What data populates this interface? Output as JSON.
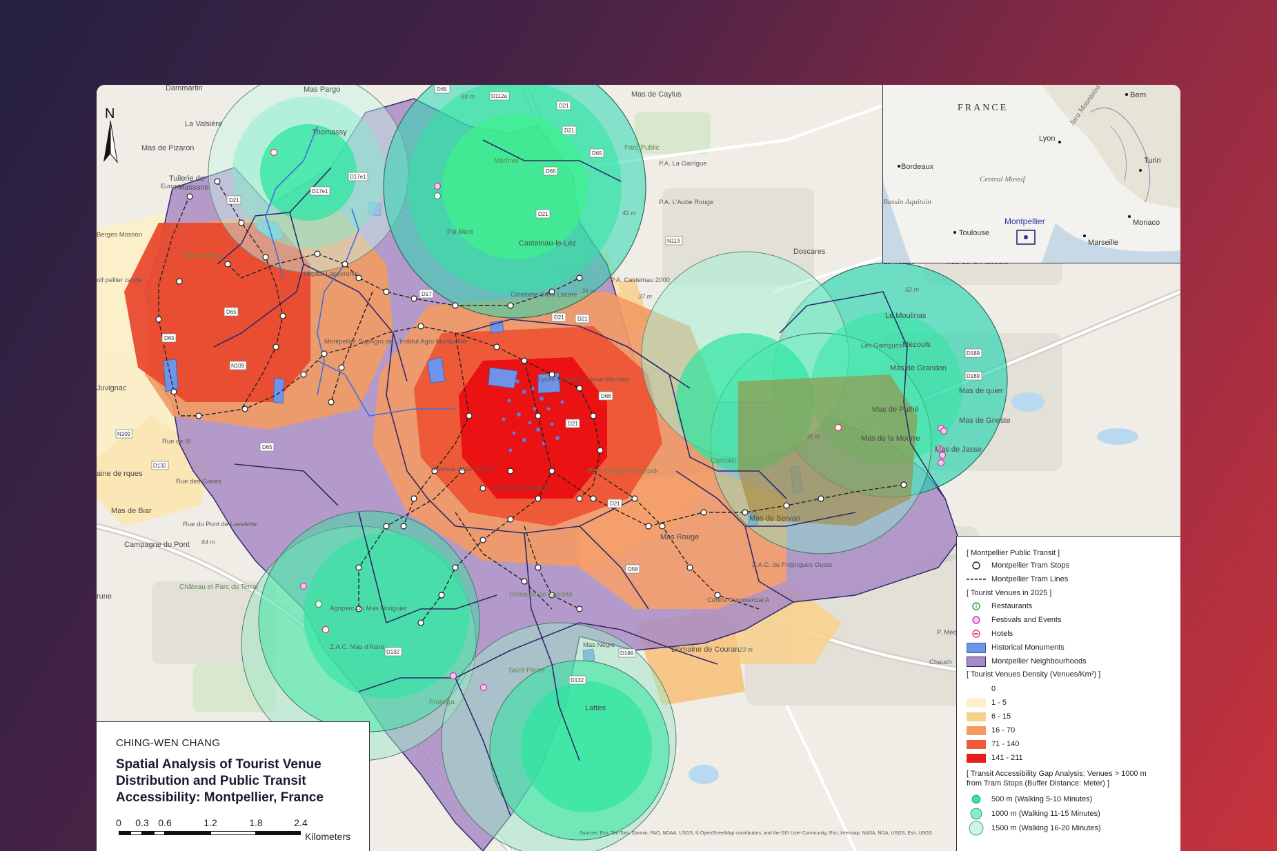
{
  "map": {
    "north_arrow": "N",
    "places": [
      {
        "id": "dammartin",
        "name": "Dammartin"
      },
      {
        "id": "mas-pargo",
        "name": "Mas Pargo"
      },
      {
        "id": "mas-de-caylus",
        "name": "Mas de Caylus"
      },
      {
        "id": "la-valsiere",
        "name": "La Valsière"
      },
      {
        "id": "thomassy",
        "name": "Thomassy"
      },
      {
        "id": "mas-de-pizaron",
        "name": "Mas de Pizaron"
      },
      {
        "id": "parc-public",
        "name": "Parc Public"
      },
      {
        "id": "pa-la-garrigue",
        "name": "P.A. La Garrigue"
      },
      {
        "id": "pa-laube-rouge",
        "name": "P.A. L'Aube Rouge"
      },
      {
        "id": "castelnau",
        "name": "Castelnau-le-Lez"
      },
      {
        "id": "doscares",
        "name": "Doscares"
      },
      {
        "id": "le-verteil",
        "name": "Le Verteil"
      },
      {
        "id": "mas-de-la-faissole",
        "name": "Mas de la Faissole"
      },
      {
        "id": "pa-castelnau-2000",
        "name": "P.A. Castelnau 2000"
      },
      {
        "id": "cimetiere",
        "name": "Cimetière Saint Lazare"
      },
      {
        "id": "hopital",
        "name": "Hôpital Lapeyronie"
      },
      {
        "id": "supagro",
        "name": "Montpellier SupAgro de L'Institut Agro Montpellier"
      },
      {
        "id": "juvignac",
        "name": "Juvignac"
      },
      {
        "id": "le-moulinas",
        "name": "Le Moulinas"
      },
      {
        "id": "mezouls",
        "name": "Mézouls"
      },
      {
        "id": "mas-de-grandon",
        "name": "Mas de Grandon"
      },
      {
        "id": "mas-de-pathe",
        "name": "Mas de Pathé"
      },
      {
        "id": "mas-de-la-mourre",
        "name": "Mas de la Mourre"
      },
      {
        "id": "mas-de-jasse",
        "name": "Mas de Jasse"
      },
      {
        "id": "mas-de-biar",
        "name": "Mas de Biar"
      },
      {
        "id": "campagne-du-pont",
        "name": "Campagne du Pont"
      },
      {
        "id": "chateau-terral",
        "name": "Château et Parc du Terral"
      },
      {
        "id": "mas-de-servan",
        "name": "Mas de Servan"
      },
      {
        "id": "mas-rouge",
        "name": "Mas Rouge"
      },
      {
        "id": "zac-frejorgues",
        "name": "Z.A.C. de Fréjorgues Ouest"
      },
      {
        "id": "centre-commercial",
        "name": "Centre Commercial A"
      },
      {
        "id": "domaine-couran",
        "name": "Domaine de Couran"
      },
      {
        "id": "lattes",
        "name": "Lattes"
      },
      {
        "id": "saint-pierre",
        "name": "Saint-Pierre"
      },
      {
        "id": "fromiga",
        "name": "Fromiga"
      },
      {
        "id": "saporta",
        "name": "Domaine de Saporta"
      },
      {
        "id": "parc-charpak",
        "name": "Parc Georges Charpak"
      },
      {
        "id": "comolet",
        "name": "Comolet"
      },
      {
        "id": "parc-malbosc",
        "name": "Parc Malbosc"
      },
      {
        "id": "martinet",
        "name": "Martinet"
      },
      {
        "id": "mas-negre",
        "name": "Mas Nègre"
      },
      {
        "id": "les-garrigues",
        "name": "Les Garrigues"
      },
      {
        "id": "rue-gieres",
        "name": "Rue des Gières"
      },
      {
        "id": "rue-lavalette",
        "name": "Rue du Pont de Lavalette"
      },
      {
        "id": "avenue-liberte",
        "name": "Avenue de la Liberté"
      },
      {
        "id": "avenue-palavas",
        "name": "Avenue de Palavas"
      },
      {
        "id": "europe",
        "name": "Europe"
      },
      {
        "id": "massane",
        "name": "Massane"
      },
      {
        "id": "tuilerie",
        "name": "Tuilerie de"
      },
      {
        "id": "berges-mosson",
        "name": "Berges Mosson"
      },
      {
        "id": "rue-bl",
        "name": "Rue de Bl"
      },
      {
        "id": "lycee",
        "name": "Lycée Polyvalent Jean Mermoz"
      },
      {
        "id": "agriparc",
        "name": "Agriparc Du Mas Nouguier"
      },
      {
        "id": "zac-mas-astre",
        "name": "Z.A.C. Mas d'Astre"
      },
      {
        "id": "chauch",
        "name": "Chauch"
      },
      {
        "id": "aine-de-rques",
        "name": "aine de rques"
      },
      {
        "id": "rune",
        "name": "rune"
      },
      {
        "id": "golf",
        "name": "olf pellier caude"
      },
      {
        "id": "mas-de-lgaquier",
        "name": "Mas de quier"
      },
      {
        "id": "mas-de-gneste",
        "name": "Mas de Gneste"
      },
      {
        "id": "mediath",
        "name": "P. Médi"
      },
      {
        "id": "pol",
        "name": "Pol Mont"
      }
    ],
    "roads": [
      "D65",
      "D112a",
      "D21",
      "D21",
      "D65",
      "D65",
      "D21",
      "N113",
      "D17e1",
      "D17e1",
      "D17",
      "D21",
      "D189",
      "D189",
      "N109",
      "D65",
      "D65",
      "N109",
      "D132",
      "D65",
      "D66",
      "D21",
      "D21",
      "D58",
      "D132",
      "D132",
      "D189",
      "D21",
      "D21"
    ],
    "elevations": [
      "59 m",
      "42 m",
      "39 m",
      "37 m",
      "52 m",
      "38 m",
      "64 m",
      "23 m"
    ],
    "sources": "Sources: Esri, TomTom, Garmin, FAO, NOAA, USGS, © OpenStreetMap contributors, and the GIS User Community; Esri, Intermap, NASA, NGA, USGS, Esri, USGS"
  },
  "inset": {
    "country": "FRANCE",
    "cities": [
      "Bern",
      "Lyon",
      "Bordeaux",
      "Turin",
      "Toulouse",
      "Monaco",
      "Marseille",
      "Montpellier"
    ],
    "regions": [
      "Jura Mountains",
      "Central Massif",
      "Bassin Aquitain"
    ]
  },
  "title_box": {
    "author": "CHING-WEN CHANG",
    "title": "Spatial Analysis of Tourist Venue Distribution and Public Transit Accessibility: Montpellier, France",
    "scale_ticks": [
      "0",
      "0.3",
      "0.6",
      "1.2",
      "1.8",
      "2.4"
    ],
    "scale_unit": "Kilometers"
  },
  "legend": {
    "transit_head": "[ Montpellier Public Transit ]",
    "tram_stops": "Montpellier Tram Stops",
    "tram_lines": "Montpellier Tram Lines",
    "venues_head": "[ Tourist Venues in 2025 ]",
    "restaurants": "Restaurants",
    "festivals": "Festivals and Events",
    "hotels": "Hotels",
    "monuments": "Historical Monuments",
    "neighbourhoods": "Montpellier Neighbourhoods",
    "density_head": "[ Tourist Venues Density (Venues/Km²) ]",
    "density_classes": [
      {
        "label": "0",
        "color": "#ffffff"
      },
      {
        "label": "1 - 5",
        "color": "#fdf0c7"
      },
      {
        "label": "6 - 15",
        "color": "#f8cf8c"
      },
      {
        "label": "16 - 70",
        "color": "#f59a5e"
      },
      {
        "label": "71 - 140",
        "color": "#ee5a3a"
      },
      {
        "label": "141 - 211",
        "color": "#ea1d1d"
      }
    ],
    "gap_head_1": "[ Transit Accessibility Gap Analysis: Venues > 1000 m",
    "gap_head_2": "from Tram Stops (Buffer Distance: Meter) ]",
    "buffers": [
      {
        "label": "500 m (Walking 5-10 Minutes)",
        "color": "#2ee6a0"
      },
      {
        "label": "1000 m (Walking 11-15 Minutes)",
        "color": "#7ff0cc"
      },
      {
        "label": "1500 m (Walking 16-20 Minutes)",
        "color": "#c9f6e8"
      }
    ]
  }
}
